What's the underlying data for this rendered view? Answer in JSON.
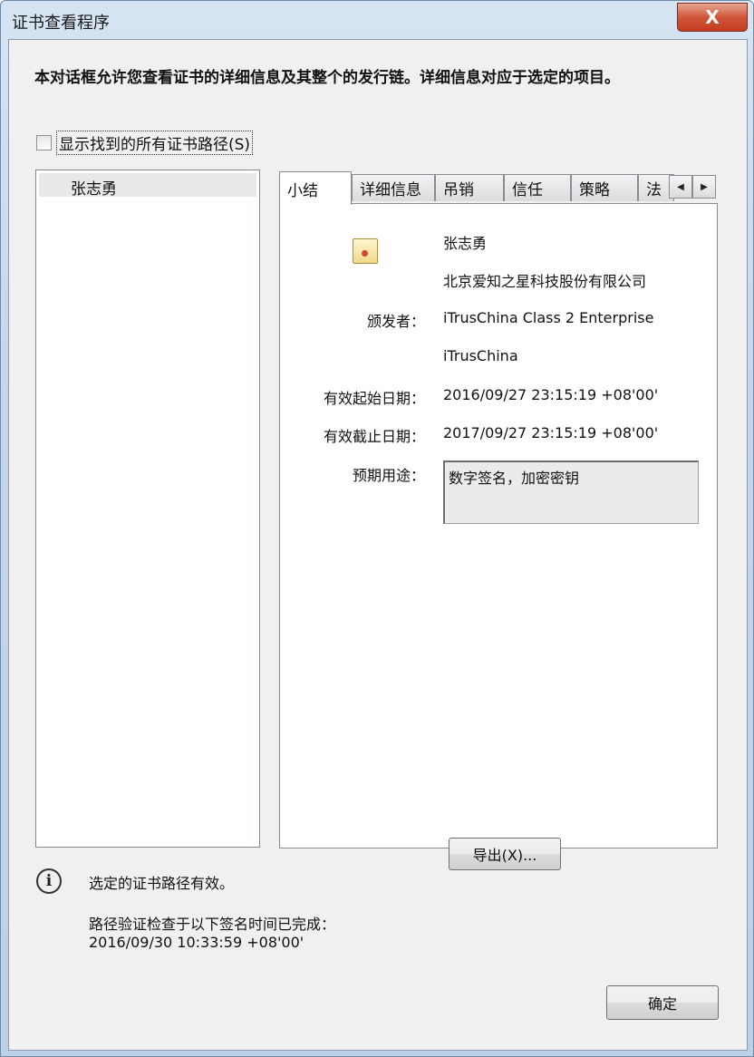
{
  "window": {
    "title": "证书查看程序",
    "close_label": "X"
  },
  "description": "本对话框允许您查看证书的详细信息及其整个的发行链。详细信息对应于选定的项目。",
  "show_all_paths": {
    "label": "显示找到的所有证书路径(S)",
    "checked": false
  },
  "tree": {
    "items": [
      {
        "label": "张志勇"
      }
    ]
  },
  "tabs": [
    {
      "label": "小结",
      "active": true
    },
    {
      "label": "详细信息"
    },
    {
      "label": "吊销"
    },
    {
      "label": "信任"
    },
    {
      "label": "策略"
    },
    {
      "label": "法"
    }
  ],
  "summary": {
    "name": "张志勇",
    "organization": "北京爱知之星科技股份有限公司",
    "issuer_label": "颁发者：",
    "issuer_value": "iTrusChina Class 2 Enterprise",
    "issuer_org": "iTrusChina",
    "valid_from_label": "有效起始日期：",
    "valid_from": "2016/09/27 23:15:19 +08'00'",
    "valid_to_label": "有效截止日期：",
    "valid_to": "2017/09/27 23:15:19 +08'00'",
    "purpose_label": "预期用途：",
    "purpose_value": "数字签名，加密密钥",
    "export_label": "导出(X)..."
  },
  "status": {
    "valid_text": "选定的证书路径有效。",
    "check_text": "路径验证检查于以下签名时间已完成：",
    "check_time": "2016/09/30 10:33:59 +08'00'"
  },
  "ok_label": "确定"
}
